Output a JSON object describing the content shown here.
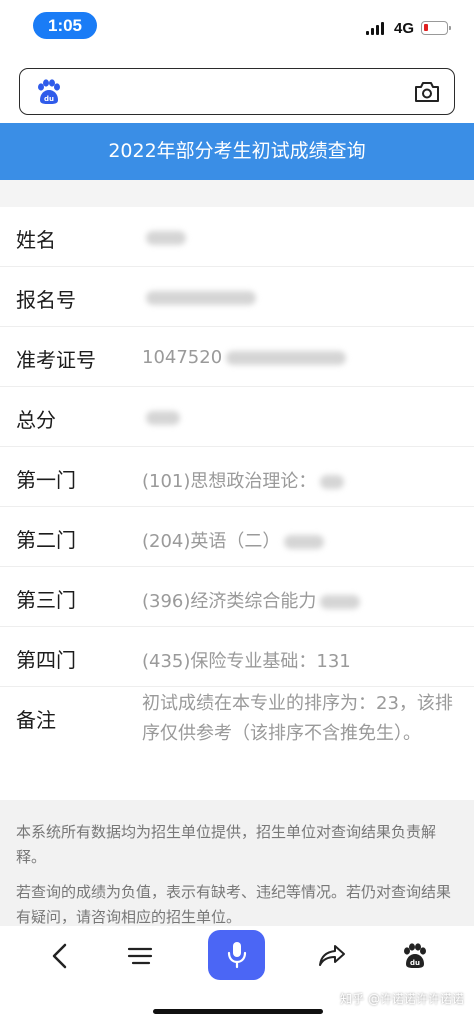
{
  "status_bar": {
    "time": "1:05",
    "network": "4G",
    "battery_color": "#e02020"
  },
  "search_bar": {
    "logo_icon": "baidu-paw-icon",
    "camera_icon": "camera-icon",
    "value": ""
  },
  "page_title": "2022年部分考生初试成绩查询",
  "rows": [
    {
      "label": "姓名",
      "value": ""
    },
    {
      "label": "报名号",
      "value": ""
    },
    {
      "label": "准考证号",
      "value": "1047520"
    },
    {
      "label": "总分",
      "value": ""
    },
    {
      "label": "第一门",
      "value": "(101)思想政治理论："
    },
    {
      "label": "第二门",
      "value": "(204)英语（二）"
    },
    {
      "label": "第三门",
      "value": "(396)经济类综合能力"
    },
    {
      "label": "第四门",
      "value": "(435)保险专业基础：131"
    },
    {
      "label": "备注",
      "value": "初试成绩在本专业的排序为：23，该排序仅供参考（该排序不含推免生）。"
    }
  ],
  "notice": [
    "本系统所有数据均为招生单位提供，招生单位对查询结果负责解释。",
    "若查询的成绩为负值，表示有缺考、违纪等情况。若仍对查询结果有疑问，请咨询相应的招生单位。"
  ],
  "toolbar": {
    "back_icon": "back-arrow-icon",
    "menu_icon": "menu-icon",
    "mic_icon": "microphone-icon",
    "share_icon": "share-icon",
    "home_icon": "baidu-paw-icon",
    "mic_color": "#4b66f5"
  },
  "watermark": "知乎 @许诺诺许许诺诺"
}
